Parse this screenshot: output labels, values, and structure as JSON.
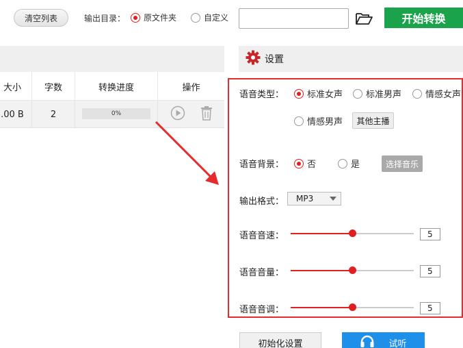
{
  "toolbar": {
    "clear_list": "清空列表",
    "output_dir_label": "输出目录：",
    "option_original": "原文件夹",
    "option_custom": "自定义",
    "path_value": "",
    "start_convert": "开始转换"
  },
  "table": {
    "headers": [
      "大小",
      "字数",
      "转换进度",
      "操作"
    ],
    "rows": [
      {
        "size": ".00 B",
        "word_count": "2",
        "progress_text": "0%",
        "progress": 0
      }
    ]
  },
  "settings": {
    "title": "设置",
    "voice_type_label": "语音类型：",
    "voice_types": [
      "标准女声",
      "标准男声",
      "情感女声",
      "情感男声"
    ],
    "selected_voice": "标准女声",
    "other_anchor": "其他主播",
    "background_label": "语音背景：",
    "background_no": "否",
    "background_yes": "是",
    "choose_music": "选择音乐",
    "format_label": "输出格式：",
    "format_value": "MP3",
    "speed_label": "语音音速：",
    "speed_value": "5",
    "volume_label": "语音音量：",
    "volume_value": "5",
    "pitch_label": "语音音调：",
    "pitch_value": "5",
    "slider_fraction": 0.5
  },
  "footer": {
    "reset": "初始化设置",
    "listen": "试听"
  },
  "colors": {
    "accent_red": "#e02020",
    "start_green": "#1aa34a",
    "listen_blue": "#1e90ea",
    "panel_border": "#e52b2b"
  }
}
